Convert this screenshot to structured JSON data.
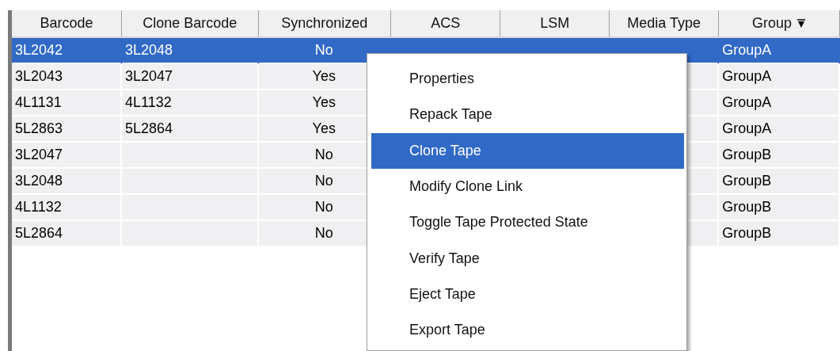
{
  "table": {
    "columns": [
      {
        "label": "Barcode",
        "sorted": false
      },
      {
        "label": "Clone Barcode",
        "sorted": false
      },
      {
        "label": "Synchronized",
        "sorted": false
      },
      {
        "label": "ACS",
        "sorted": false
      },
      {
        "label": "LSM",
        "sorted": false
      },
      {
        "label": "Media Type",
        "sorted": false
      },
      {
        "label": "Group",
        "sorted": true
      }
    ],
    "rows": [
      {
        "selected": true,
        "barcode": "3L2042",
        "clone_barcode": "3L2048",
        "synchronized": "No",
        "group": "GroupA"
      },
      {
        "selected": false,
        "barcode": "3L2043",
        "clone_barcode": "3L2047",
        "synchronized": "Yes",
        "group": "GroupA"
      },
      {
        "selected": false,
        "barcode": "4L1131",
        "clone_barcode": "4L1132",
        "synchronized": "Yes",
        "group": "GroupA"
      },
      {
        "selected": false,
        "barcode": "5L2863",
        "clone_barcode": "5L2864",
        "synchronized": "Yes",
        "group": "GroupA"
      },
      {
        "selected": false,
        "barcode": "3L2047",
        "synchronized": "No",
        "group": "GroupB"
      },
      {
        "selected": false,
        "barcode": "3L2048",
        "synchronized": "No",
        "group": "GroupB"
      },
      {
        "selected": false,
        "barcode": "4L1132",
        "synchronized": "No",
        "group": "GroupB"
      },
      {
        "selected": false,
        "barcode": "5L2864",
        "synchronized": "No",
        "group": "GroupB"
      }
    ]
  },
  "context_menu": {
    "items": [
      {
        "label": "Properties",
        "selected": false
      },
      {
        "label": "Repack Tape",
        "selected": false
      },
      {
        "label": "Clone Tape",
        "selected": true
      },
      {
        "label": "Modify Clone Link",
        "selected": false
      },
      {
        "label": "Toggle Tape Protected State",
        "selected": false
      },
      {
        "label": "Verify Tape",
        "selected": false
      },
      {
        "label": "Eject Tape",
        "selected": false
      },
      {
        "label": "Export Tape",
        "selected": false
      }
    ]
  }
}
